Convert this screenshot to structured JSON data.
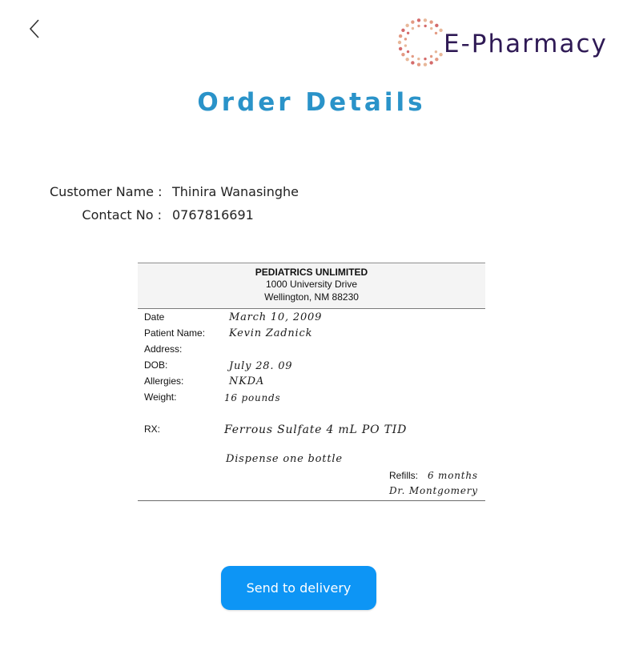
{
  "header": {
    "back_icon": "chevron-left-icon",
    "brand_name": "E-Pharmacy",
    "brand_colors": {
      "text": "#2f1a55",
      "dots": [
        "#e39a83",
        "#d46b6b",
        "#e8b89a"
      ]
    }
  },
  "page": {
    "title": "Order Details",
    "title_color": "#2a93c9"
  },
  "customer": {
    "name_label": "Customer Name :",
    "name_value": "Thinira Wanasinghe",
    "contact_label": "Contact No :",
    "contact_value": "0767816691"
  },
  "prescription": {
    "clinic_name": "PEDIATRICS UNLIMITED",
    "address_line1": "1000 University Drive",
    "address_line2": "Wellington, NM 88230",
    "fields": {
      "date_label": "Date",
      "date_value": "March 10, 2009",
      "patient_label": "Patient Name:",
      "patient_value": "Kevin Zadnick",
      "address_label": "Address:",
      "address_value": "",
      "dob_label": "DOB:",
      "dob_value": "July 28. 09",
      "allergies_label": "Allergies:",
      "allergies_value": "NKDA",
      "weight_label": "Weight:",
      "weight_value": "16 pounds",
      "rx_label": "RX:",
      "rx_value": "Ferrous Sulfate 4 mL PO TID",
      "dispense_value": "Dispense one bottle",
      "refills_label": "Refills:",
      "refills_value": "6 months",
      "doctor_value": "Dr. Montgomery"
    }
  },
  "actions": {
    "send_label": "Send to delivery",
    "send_color": "#0d95f5"
  }
}
